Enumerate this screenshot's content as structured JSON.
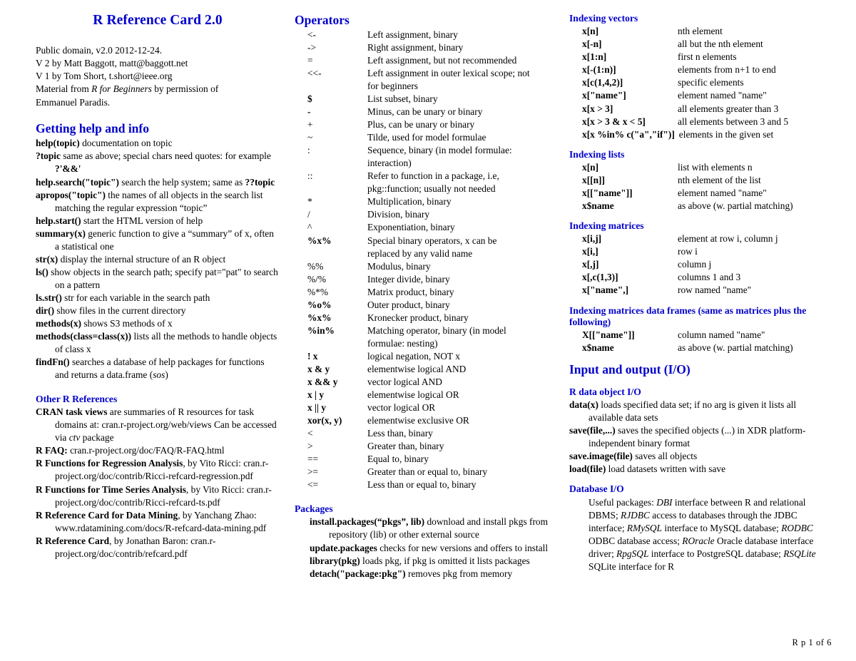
{
  "document": {
    "title": "R Reference Card 2.0",
    "footer": "R p 1 of 6",
    "heading_color": "#0000CC"
  },
  "intro": {
    "lines": [
      "Public domain, v2.0 2012-12-24.",
      "V 2 by Matt Baggott, matt@baggott.net",
      "V 1 by Tom Short, t.short@ieee.org"
    ],
    "material_prefix": "Material from ",
    "material_italic": "R for Beginners",
    "material_suffix": " by permission of",
    "material_line2": "Emmanuel Paradis."
  },
  "getting_help": {
    "heading": "Getting help and info",
    "entries": [
      {
        "term": "help(topic)",
        "desc": " documentation on topic"
      },
      {
        "term": "?topic",
        "desc": " same as above; special chars need quotes: for example ",
        "bold_tail": "?'&&'"
      },
      {
        "term": "help.search(\"topic\")",
        "desc": " search the help system; same as ",
        "bold_tail": "??topic"
      },
      {
        "term": "apropos(\"topic\")",
        "desc": " the names of all objects in the search list matching the regular expression “topic”"
      },
      {
        "term": "help.start()",
        "desc": " start the HTML version of help"
      },
      {
        "term": "summary(x)",
        "desc": " generic function to give a “summary” of x, often a statistical one"
      },
      {
        "term": "str(x)",
        "desc": " display the internal structure of an R object"
      },
      {
        "term": "ls()",
        "desc": " show objects in the search path; specify pat=\"pat\" to search on a pattern"
      },
      {
        "term": "ls.str()",
        "desc": " str for each variable in the search path"
      },
      {
        "term": "dir()",
        "desc": " show files in the current directory"
      },
      {
        "term": "methods(x)",
        "desc": " shows S3 methods of x"
      },
      {
        "term": "methods(class=class(x))",
        "desc": " lists all the methods to handle objects of class x"
      },
      {
        "term": "findFn()",
        "desc": " searches a database of help packages for functions and returns a data.frame (",
        "italic_tail": "sos",
        "tail": ")"
      }
    ]
  },
  "other_refs": {
    "heading": "Other R References",
    "entries": [
      {
        "term": "CRAN task views",
        "desc": " are summaries of R resources for task domains at: cran.r-project.org/web/views Can be accessed via ",
        "italic_tail": "ctv",
        "tail": " package"
      },
      {
        "term": "R FAQ:",
        "desc": "  cran.r-project.org/doc/FAQ/R-FAQ.html"
      },
      {
        "term": "R Functions for Regression Analysis",
        "desc": ", by Vito Ricci: cran.r-project.org/doc/contrib/Ricci-refcard-regression.pdf"
      },
      {
        "term": "R Functions for Time Series Analysis",
        "desc": ", by Vito Ricci: cran.r-project.org/doc/contrib/Ricci-refcard-ts.pdf"
      },
      {
        "term": "R Reference Card for Data Mining",
        "desc": ", by Yanchang Zhao: www.rdatamining.com/docs/R-refcard-data-mining.pdf"
      },
      {
        "term": "R Reference Card",
        "desc": ", by Jonathan Baron: cran.r-project.org/doc/contrib/refcard.pdf"
      }
    ]
  },
  "operators": {
    "heading": "Operators",
    "rows": [
      {
        "sym": "<-",
        "bold": false,
        "desc": "Left assignment, binary"
      },
      {
        "sym": "->",
        "bold": false,
        "desc": "Right assignment, binary"
      },
      {
        "sym": "=",
        "bold": false,
        "desc": "Left assignment, but not recommended"
      },
      {
        "sym": "<<-",
        "bold": false,
        "desc": "Left assignment in outer lexical scope; not",
        "cont": "for beginners"
      },
      {
        "sym": "$",
        "bold": true,
        "desc": "List subset, binary"
      },
      {
        "sym": "-",
        "bold": true,
        "desc": "Minus, can be unary or binary"
      },
      {
        "sym": "+",
        "bold": false,
        "desc": "Plus, can be unary or binary"
      },
      {
        "sym": "~",
        "bold": false,
        "desc": "Tilde, used for model formulae"
      },
      {
        "sym": ":",
        "bold": false,
        "desc": "Sequence, binary (in model formulae:",
        "cont": "interaction)"
      },
      {
        "sym": "::",
        "bold": false,
        "desc": "Refer to function in a package, i.e,",
        "cont": "pkg::function; usually not needed"
      },
      {
        "sym": "*",
        "bold": false,
        "desc": "Multiplication, binary"
      },
      {
        "sym": "/",
        "bold": false,
        "desc": "Division, binary"
      },
      {
        "sym": "^",
        "bold": false,
        "desc": "Exponentiation, binary"
      },
      {
        "sym": "%x%",
        "bold": true,
        "desc": "Special binary operators, x can be",
        "cont": "replaced by any valid name"
      },
      {
        "sym": "%%",
        "bold": false,
        "desc": "Modulus, binary"
      },
      {
        "sym": "%/%",
        "bold": false,
        "desc": "Integer divide, binary"
      },
      {
        "sym": "%*%",
        "bold": false,
        "desc": "Matrix product, binary"
      },
      {
        "sym": "%o%",
        "bold": true,
        "desc": "Outer product, binary"
      },
      {
        "sym": "%x%",
        "bold": true,
        "desc": "Kronecker product, binary"
      },
      {
        "sym": "%in%",
        "bold": true,
        "desc": "Matching operator, binary (in model",
        "cont": "formulae: nesting)"
      },
      {
        "sym": "! x",
        "bold": true,
        "desc": "logical negation, NOT x"
      },
      {
        "sym": "x & y",
        "bold": true,
        "desc": "elementwise logical AND"
      },
      {
        "sym": "x && y",
        "bold": true,
        "desc": "vector logical AND"
      },
      {
        "sym": "x | y",
        "bold": true,
        "desc": "elementwise logical OR"
      },
      {
        "sym": "x || y",
        "bold": true,
        "desc": "vector logical OR"
      },
      {
        "sym": "xor(x, y)",
        "bold": true,
        "desc": "elementwise exclusive OR"
      },
      {
        "sym": "<",
        "bold": false,
        "desc": "Less than, binary"
      },
      {
        "sym": ">",
        "bold": false,
        "desc": "Greater than, binary"
      },
      {
        "sym": "==",
        "bold": false,
        "desc": "Equal to, binary"
      },
      {
        "sym": ">=",
        "bold": false,
        "desc": "Greater than or equal to, binary"
      },
      {
        "sym": "<=",
        "bold": false,
        "desc": "Less than or equal to, binary"
      }
    ]
  },
  "packages": {
    "heading": "Packages",
    "entries": [
      {
        "term": "install.packages(“pkgs”, lib)",
        "desc": " download and install pkgs from repository (lib) or other external source"
      },
      {
        "term": "update.packages",
        "desc": " checks for new versions and offers to install"
      },
      {
        "term": "library(pkg)",
        "desc": " loads pkg, if pkg is omitted it lists packages"
      },
      {
        "term": "detach(\"package:pkg\")",
        "desc": " removes pkg from memory"
      }
    ]
  },
  "indexing_vectors": {
    "heading": "Indexing vectors",
    "rows": [
      {
        "sym": "x[n]",
        "desc": "nth element"
      },
      {
        "sym": "x[-n]",
        "desc": "all but the nth element"
      },
      {
        "sym": "x[1:n]",
        "desc": "first n elements"
      },
      {
        "sym": "x[-(1:n)]",
        "desc": "elements from n+1 to end"
      },
      {
        "sym": "x[c(1,4,2)]",
        "desc": "specific elements"
      },
      {
        "sym": "x[\"name\"]",
        "desc": "element named \"name\""
      },
      {
        "sym": "x[x > 3]",
        "desc": "all elements greater than 3"
      },
      {
        "sym": "x[x > 3 & x < 5]",
        "desc": "all elements between 3 and 5"
      },
      {
        "sym": "x[x %in% c(\"a\",\"if\")]",
        "desc": " elements in the given set",
        "wide": true
      }
    ]
  },
  "indexing_lists": {
    "heading": "Indexing lists",
    "rows": [
      {
        "sym": "x[n]",
        "desc": "list with elements n"
      },
      {
        "sym": "x[[n]]",
        "desc": "nth element of the list"
      },
      {
        "sym": "x[[\"name\"]]",
        "desc": "element named \"name\""
      },
      {
        "sym": "x$name",
        "desc": "as above (w. partial matching)"
      }
    ]
  },
  "indexing_matrices": {
    "heading": "Indexing matrices",
    "rows": [
      {
        "sym": "x[i,j]",
        "desc": "element at row i, column j"
      },
      {
        "sym": "x[i,]",
        "desc": "row i"
      },
      {
        "sym": "x[,j]",
        "desc": "column j"
      },
      {
        "sym": "x[,c(1,3)]",
        "desc": "columns 1 and 3"
      },
      {
        "sym": "x[\"name\",]",
        "desc": "row named \"name\""
      }
    ]
  },
  "indexing_data_frames": {
    "heading": "Indexing matrices data frames (same as matrices plus the following)",
    "rows": [
      {
        "sym": "X[[\"name\"]]",
        "desc": "column named \"name\""
      },
      {
        "sym": "x$name",
        "desc": "as above (w. partial matching)"
      }
    ]
  },
  "io": {
    "heading": "Input and output (I/O)",
    "r_data_object": {
      "heading": "R data object I/O",
      "entries": [
        {
          "term": "data(x)",
          "desc": " loads specified data set; if no arg is given it lists all available data sets"
        },
        {
          "term": "save(file,...)",
          "desc": " saves the specified objects (...) in XDR platform-independent binary format"
        },
        {
          "term": "save.image(file)",
          "desc": " saves all objects"
        },
        {
          "term": "load(file)",
          "desc": " load datasets written with save"
        }
      ]
    },
    "database": {
      "heading": "Database I/O",
      "text_prefix": "Useful packages: ",
      "parts": [
        {
          "italic": "DBI",
          "text": " interface between R and relational DBMS; "
        },
        {
          "italic": "RJDBC",
          "text": " access to databases through the JDBC interface; "
        },
        {
          "italic": "RMySQL",
          "text": " interface to MySQL database; "
        },
        {
          "italic": "RODBC",
          "text": " ODBC database access; "
        },
        {
          "italic": "ROracle",
          "text": " Oracle database interface driver; "
        },
        {
          "italic": "RpgSQL",
          "text": " interface to PostgreSQL database; "
        },
        {
          "italic": "RSQLite",
          "text": " SQLite interface for R"
        }
      ]
    }
  }
}
